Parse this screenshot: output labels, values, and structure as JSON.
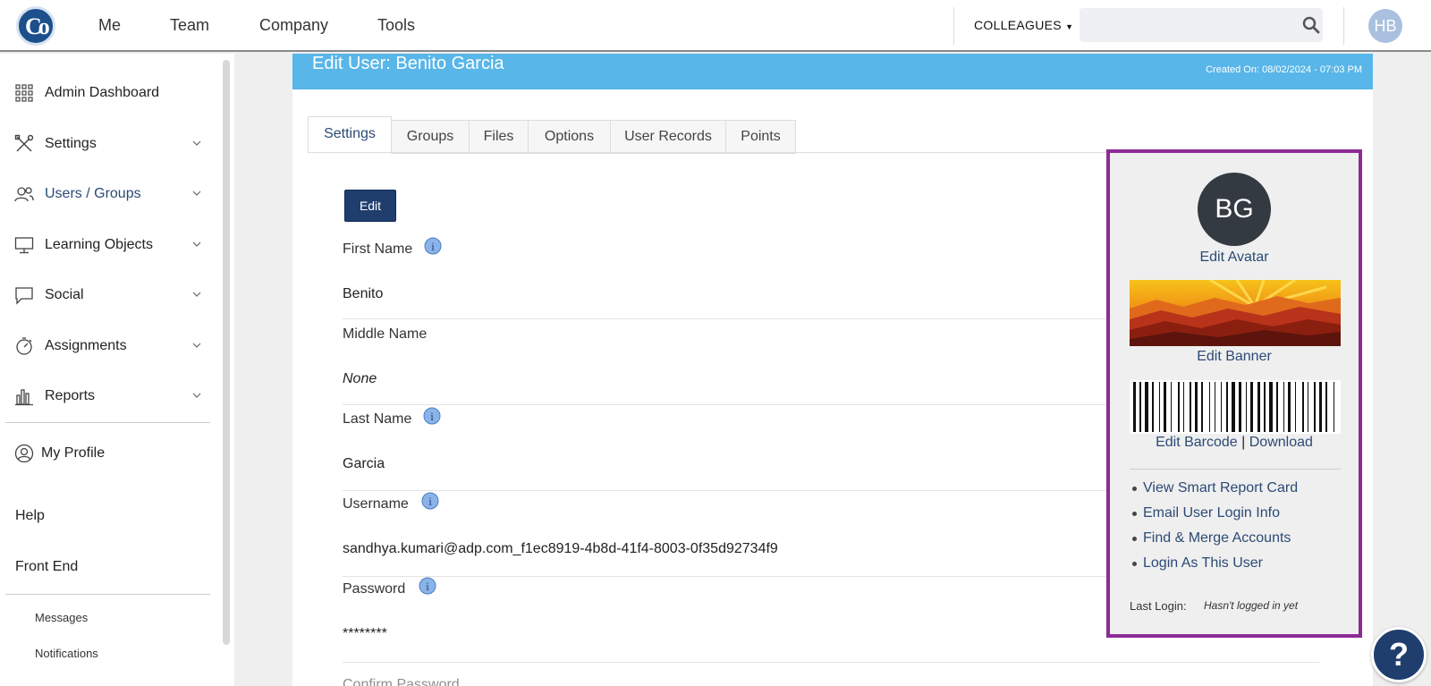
{
  "topnav": {
    "logo_text": "Co",
    "items": [
      "Me",
      "Team",
      "Company",
      "Tools"
    ],
    "colleagues_label": "COLLEAGUES",
    "search_placeholder": "",
    "user_initials": "HB"
  },
  "sidebar": {
    "items": [
      {
        "label": "Admin Dashboard",
        "icon": "grid-icon",
        "has_chevron": false
      },
      {
        "label": "Settings",
        "icon": "tools-icon",
        "has_chevron": true
      },
      {
        "label": "Users / Groups",
        "icon": "users-icon",
        "has_chevron": true,
        "active": true
      },
      {
        "label": "Learning Objects",
        "icon": "monitor-icon",
        "has_chevron": true
      },
      {
        "label": "Social",
        "icon": "chat-icon",
        "has_chevron": true
      },
      {
        "label": "Assignments",
        "icon": "stopwatch-icon",
        "has_chevron": true
      },
      {
        "label": "Reports",
        "icon": "bar-chart-icon",
        "has_chevron": true
      }
    ],
    "my_profile": "My Profile",
    "help": "Help",
    "front_end": "Front End",
    "messages": "Messages",
    "notifications": "Notifications"
  },
  "main": {
    "title": "Edit User: Benito Garcia",
    "created_on": "Created On: 08/02/2024 - 07:03 PM",
    "tabs": [
      "Settings",
      "Groups",
      "Files",
      "Options",
      "User Records",
      "Points"
    ],
    "active_tab": "Settings",
    "edit_button": "Edit",
    "fields": {
      "first_name_label": "First Name",
      "first_name_value": "Benito",
      "middle_name_label": "Middle Name",
      "middle_name_value": "None",
      "last_name_label": "Last Name",
      "last_name_value": "Garcia",
      "username_label": "Username",
      "username_value": "sandhya.kumari@adp.com_f1ec8919-4b8d-41f4-8003-0f35d92734f9",
      "password_label": "Password",
      "password_value": "********",
      "confirm_password_label": "Confirm Password"
    }
  },
  "panel": {
    "avatar_initials": "BG",
    "edit_avatar": "Edit Avatar",
    "edit_banner": "Edit Banner",
    "edit_barcode": "Edit Barcode",
    "barcode_separator": "|",
    "download": "Download",
    "links": [
      "View Smart Report Card",
      "Email User Login Info",
      "Find & Merge Accounts",
      "Login As This User"
    ],
    "last_login_label": "Last Login:",
    "last_login_value": "Hasn't logged in yet"
  },
  "help_button": "?",
  "colors": {
    "header_blue": "#58b6e8",
    "navy": "#1f3e6e",
    "panel_border": "#8d2b96",
    "link": "#2c4a75"
  }
}
